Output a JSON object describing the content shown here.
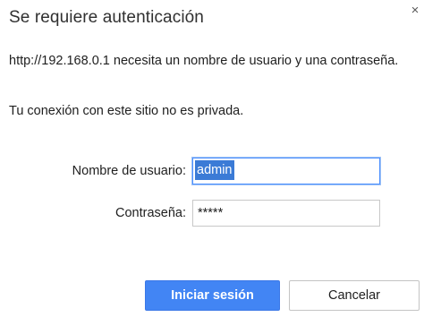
{
  "dialog": {
    "title": "Se requiere autenticación",
    "close_glyph": "×",
    "message": "http://192.168.0.1 necesita un nombre de usuario y una contraseña.",
    "privacy_note": "Tu conexión con este sitio no es privada."
  },
  "form": {
    "username_label": "Nombre de usuario:",
    "username_value": "admin",
    "password_label": "Contraseña:",
    "password_masked": "*****"
  },
  "buttons": {
    "login_label": "Iniciar sesión",
    "cancel_label": "Cancelar"
  },
  "icons": {
    "close": "close-icon"
  },
  "colors": {
    "primary": "#4285f4",
    "focus_ring": "#4d90fe",
    "selection": "#3b7bd6"
  }
}
